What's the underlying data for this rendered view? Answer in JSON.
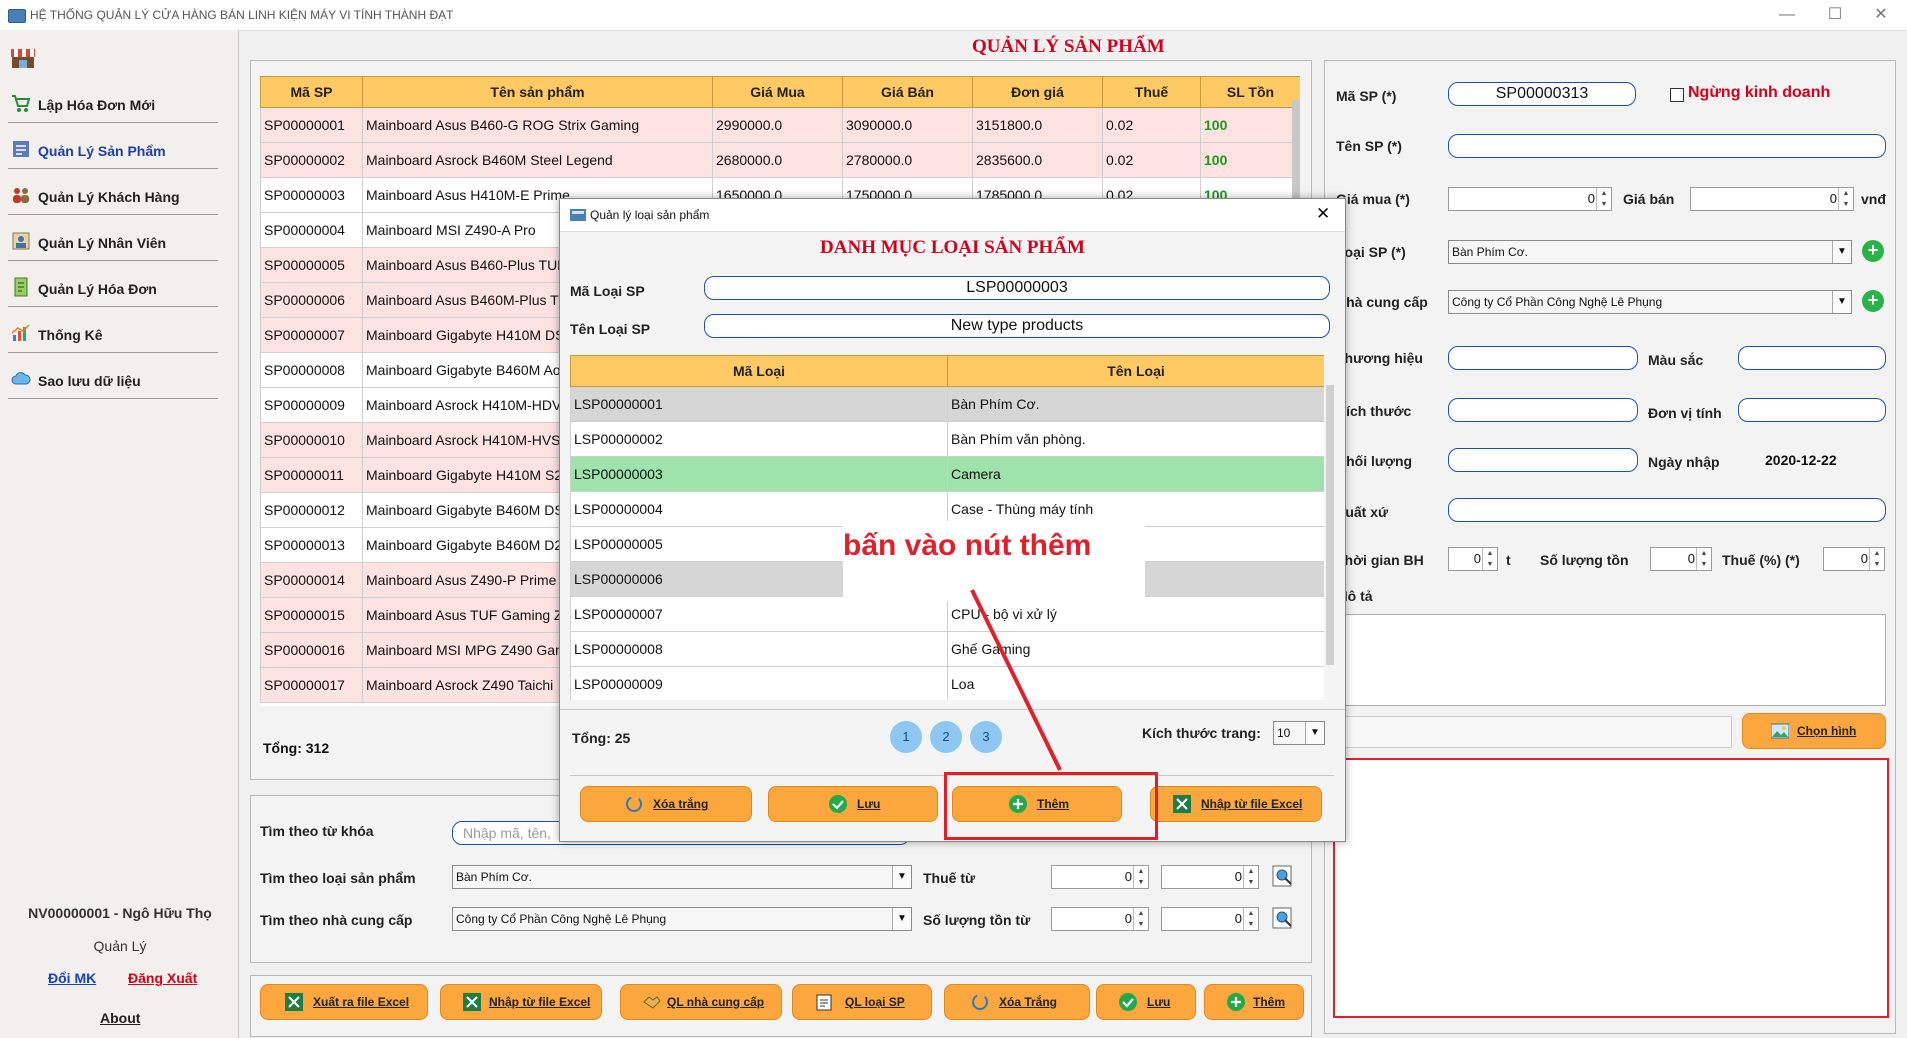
{
  "window": {
    "title": "HỆ THỐNG QUẢN LÝ CỬA HÀNG BÁN LINH KIỆN MÁY VI TÍNH THÀNH ĐẠT",
    "minimize": "—",
    "maximize": "☐",
    "close": "✕"
  },
  "nav": {
    "items": [
      {
        "label": "Lập Hóa Đơn Mới",
        "icon": "cart-icon"
      },
      {
        "label": "Quản Lý Sản Phẩm",
        "icon": "product-icon",
        "active": true
      },
      {
        "label": "Quản Lý Khách Hàng",
        "icon": "customers-icon"
      },
      {
        "label": "Quản Lý Nhân Viên",
        "icon": "employee-icon"
      },
      {
        "label": "Quản Lý Hóa Đơn",
        "icon": "invoice-icon"
      },
      {
        "label": "Thống Kê",
        "icon": "chart-icon"
      },
      {
        "label": "Sao lưu dữ liệu",
        "icon": "backup-icon"
      }
    ],
    "user": "NV00000001 - Ngô Hữu  Thọ",
    "role": "Quản Lý",
    "change_password": "Đổi MK",
    "logout": "Đăng Xuất",
    "about": "About"
  },
  "products": {
    "title": "QUẢN LÝ SẢN PHẨM",
    "columns": [
      "Mã SP",
      "Tên sản phẩm",
      "Giá Mua",
      "Giá Bán",
      "Đơn giá",
      "Thuế",
      "SL Tồn"
    ],
    "rows": [
      [
        "SP00000001",
        "Mainboard Asus B460-G ROG Strix Gaming",
        "2990000.0",
        "3090000.0",
        "3151800.0",
        "0.02",
        "100"
      ],
      [
        "SP00000002",
        "Mainboard Asrock B460M Steel Legend",
        "2680000.0",
        "2780000.0",
        "2835600.0",
        "0.02",
        "100"
      ],
      [
        "SP00000003",
        "Mainboard Asus H410M-E Prime",
        "1650000.0",
        "1750000.0",
        "1785000.0",
        "0.02",
        "100"
      ],
      [
        "SP00000004",
        "Mainboard MSI Z490-A Pro",
        "",
        "",
        "",
        "",
        ""
      ],
      [
        "SP00000005",
        "Mainboard Asus B460-Plus TUF",
        "",
        "",
        "",
        "",
        ""
      ],
      [
        "SP00000006",
        "Mainboard Asus B460M-Plus TU",
        "",
        "",
        "",
        "",
        ""
      ],
      [
        "SP00000007",
        "Mainboard Gigabyte H410M DS",
        "",
        "",
        "",
        "",
        ""
      ],
      [
        "SP00000008",
        "Mainboard Gigabyte B460M Ao",
        "",
        "",
        "",
        "",
        ""
      ],
      [
        "SP00000009",
        "Mainboard Asrock H410M-HDV",
        "",
        "",
        "",
        "",
        ""
      ],
      [
        "SP00000010",
        "Mainboard Asrock H410M-HVS",
        "",
        "",
        "",
        "",
        ""
      ],
      [
        "SP00000011",
        "Mainboard Gigabyte H410M S2",
        "",
        "",
        "",
        "",
        ""
      ],
      [
        "SP00000012",
        "Mainboard Gigabyte B460M DS",
        "",
        "",
        "",
        "",
        ""
      ],
      [
        "SP00000013",
        "Mainboard Gigabyte B460M D2",
        "",
        "",
        "",
        "",
        ""
      ],
      [
        "SP00000014",
        "Mainboard Asus Z490-P Prime",
        "",
        "",
        "",
        "",
        ""
      ],
      [
        "SP00000015",
        "Mainboard Asus TUF Gaming Z",
        "",
        "",
        "",
        "",
        ""
      ],
      [
        "SP00000016",
        "Mainboard MSI MPG Z490 Gam",
        "",
        "",
        "",
        "",
        ""
      ],
      [
        "SP00000017",
        "Mainboard Asrock Z490 Taichi",
        "",
        "",
        "",
        "",
        ""
      ]
    ],
    "total": "Tổng: 312"
  },
  "filter": {
    "keyword_label": "Tìm theo từ khóa",
    "keyword_placeholder": "Nhập mã, tên,",
    "type_label": "Tìm theo loại sản phẩm",
    "type_value": "Bàn Phím Cơ.",
    "supplier_label": "Tìm theo nhà cung cấp",
    "supplier_value": "Công ty Cổ Phần Công Nghệ Lê Phụng",
    "tax_label": "Thuế từ",
    "stock_label": "Số lượng tồn từ",
    "zero": "0"
  },
  "bottom_buttons": [
    "Xuất ra file Excel",
    "Nhập từ file Excel",
    "QL nhà cung cấp",
    "QL loại SP",
    "Xóa Trắng",
    "Lưu",
    "Thêm"
  ],
  "form": {
    "id_label": "Mã SP (*)",
    "id_value": "SP00000313",
    "discontinued": "Ngừng kinh doanh",
    "name_label": "Tên SP (*)",
    "buy_label": "Giá mua (*)",
    "buy_value": "0",
    "sell_label": "Giá bán",
    "sell_value": "0",
    "currency": "vnđ",
    "type_label": "Loại SP (*)",
    "type_value": "Bàn Phím Cơ.",
    "supplier_label": "Nhà cung cấp",
    "supplier_value": "Công ty Cổ Phần Công Nghệ Lê Phụng",
    "brand_label": "Thương hiệu",
    "color_label": "Màu sắc",
    "size_label": "Kích thước",
    "unit_label": "Đơn vị tính",
    "weight_label": "Khối lượng",
    "date_label": "Ngày nhập",
    "date_value": "2020-12-22",
    "origin_label": "Xuất xứ",
    "warranty_label": "Thời gian BH",
    "warranty_value": "0",
    "warranty_unit": "t",
    "stock_label": "Số lượng tồn",
    "stock_value": "0",
    "tax_label": "Thuế (%) (*)",
    "tax_value": "0",
    "desc_label": "Mô tả",
    "choose_image": "Chọn hình"
  },
  "dialog": {
    "window_title": "Quản lý loại sản phẩm",
    "close": "✕",
    "title": "DANH MỤC LOẠI SẢN PHẨM",
    "id_label": "Mã Loại SP",
    "id_value": "LSP00000003",
    "name_label": "Tên Loại SP",
    "name_value": "New type products",
    "columns": [
      "Mã Loại",
      "Tên Loại"
    ],
    "rows": [
      [
        "LSP00000001",
        "Bàn Phím Cơ."
      ],
      [
        "LSP00000002",
        "Bàn Phím văn phòng."
      ],
      [
        "LSP00000003",
        "Camera"
      ],
      [
        "LSP00000004",
        "Case - Thùng máy tính"
      ],
      [
        "LSP00000005",
        ""
      ],
      [
        "LSP00000006",
        ""
      ],
      [
        "LSP00000007",
        "CPU - bộ vi xử lý"
      ],
      [
        "LSP00000008",
        "Ghế Gaming"
      ],
      [
        "LSP00000009",
        "Loa"
      ]
    ],
    "total": "Tổng: 25",
    "pages": [
      "1",
      "2",
      "3"
    ],
    "page_size_label": "Kích thước trang:",
    "page_size": "10",
    "buttons": [
      "Xóa trắng",
      "Lưu",
      "Thêm",
      "Nhập từ file Excel"
    ]
  },
  "annotation": {
    "text": "bấn vào nút thêm",
    "color": "#e0202a"
  }
}
